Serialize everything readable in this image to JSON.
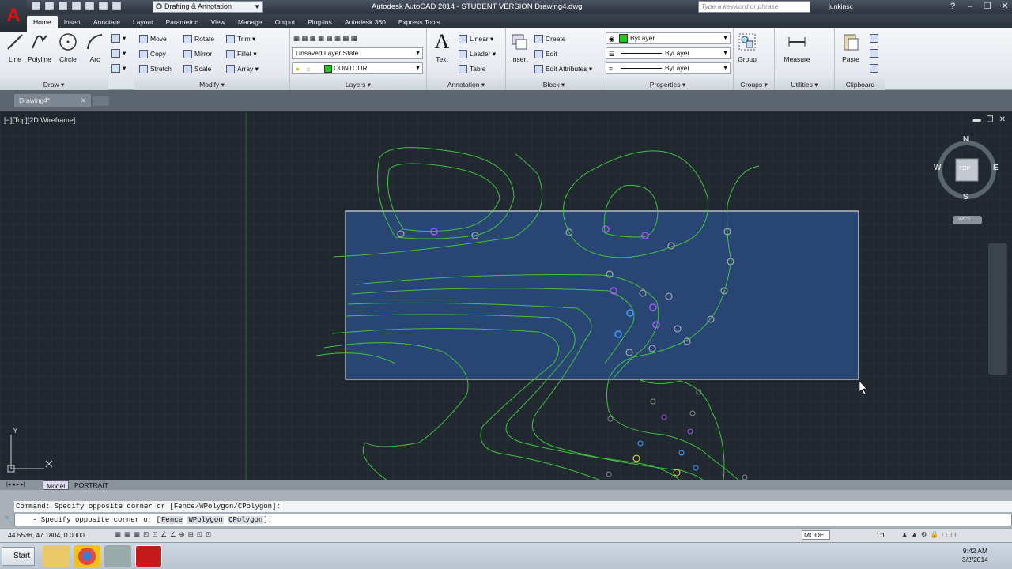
{
  "title_bar": {
    "workspace": "Drafting & Annotation",
    "title": "Autodesk AutoCAD 2014 - STUDENT VERSION    Drawing4.dwg",
    "search_placeholder": "Type a keyword or phrase",
    "user": "junkinsc"
  },
  "ribbon_tabs": [
    "Home",
    "Insert",
    "Annotate",
    "Layout",
    "Parametric",
    "View",
    "Manage",
    "Output",
    "Plug-ins",
    "Autodesk 360",
    "Express Tools"
  ],
  "panels": {
    "draw": {
      "title": "Draw",
      "line": "Line",
      "polyline": "Polyline",
      "circle": "Circle",
      "arc": "Arc"
    },
    "modify": {
      "title": "Modify",
      "move": "Move",
      "rotate": "Rotate",
      "trim": "Trim",
      "copy": "Copy",
      "mirror": "Mirror",
      "fillet": "Fillet",
      "stretch": "Stretch",
      "scale": "Scale",
      "array": "Array"
    },
    "layers": {
      "title": "Layers",
      "layer_state": "Unsaved Layer State",
      "current_layer": "CONTOUR"
    },
    "annotation": {
      "title": "Annotation",
      "text": "Text",
      "linear": "Linear",
      "leader": "Leader",
      "table": "Table"
    },
    "block": {
      "title": "Block",
      "insert": "Insert",
      "create": "Create",
      "edit": "Edit",
      "edit_attributes": "Edit Attributes"
    },
    "properties": {
      "title": "Properties",
      "color": "ByLayer",
      "linetype": "ByLayer",
      "lineweight": "ByLayer"
    },
    "groups": {
      "title": "Groups",
      "group": "Group"
    },
    "utilities": {
      "title": "Utilities",
      "measure": "Measure"
    },
    "clipboard": {
      "title": "Clipboard",
      "paste": "Paste"
    }
  },
  "document_tab": "Drawing4*",
  "viewport": {
    "label": "[−][Top][2D Wireframe]",
    "viewcube": {
      "n": "N",
      "s": "S",
      "e": "E",
      "w": "W",
      "top": "TOP",
      "wcs": "WCS"
    },
    "ucs_y": "Y"
  },
  "layout_tabs": [
    "Model",
    "PORTRAIT"
  ],
  "command": {
    "history": "Command: Specify opposite corner or [Fence/WPolygon/CPolygon]:",
    "prompt_prefix": "- Specify opposite corner or [",
    "opt_fence": "Fence",
    "opt_wpolygon": "WPolygon",
    "opt_cpolygon": "CPolygon",
    "prompt_suffix": "]:"
  },
  "status_bar": {
    "coords": "44.5536, 47.1804, 0.0000",
    "model": "MODEL",
    "scale": "1:1"
  },
  "taskbar": {
    "start": "Start",
    "time": "9:42 AM",
    "date": "3/2/2014"
  },
  "colors": {
    "contour": "#3ec43e",
    "selection_fill": "#2a4a80",
    "viewport_bg": "#212830"
  }
}
